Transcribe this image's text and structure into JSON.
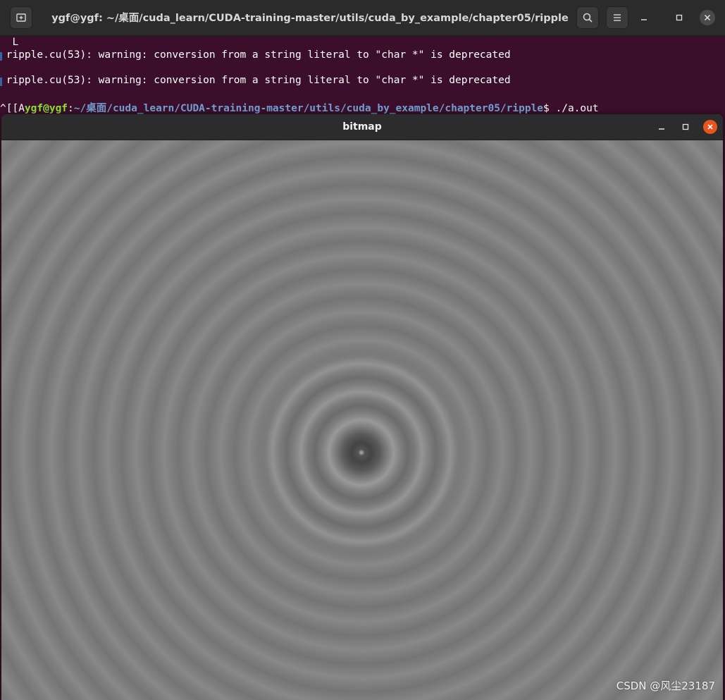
{
  "terminal": {
    "title": "ygf@ygf: ~/桌面/cuda_learn/CUDA-training-master/utils/cuda_by_example/chapter05/ripple",
    "lines": [
      "L",
      "ripple.cu(53): warning: conversion from a string literal to \"char *\" is deprecated",
      "ripple.cu(53): warning: conversion from a string literal to \"char *\" is deprecated"
    ],
    "prompt": {
      "prefix": "^[[A",
      "user": "ygf@ygf",
      "sep": ":",
      "path": "~/桌面/cuda_learn/CUDA-training-master/utils/cuda_by_example/chapter05/ripple",
      "symbol": "$ ",
      "command": "./a.out"
    },
    "icons": {
      "new_tab": "new-tab-icon",
      "search": "search-icon",
      "menu": "hamburger-menu-icon",
      "minimize": "minimize-icon",
      "maximize": "maximize-icon",
      "close": "close-icon"
    }
  },
  "bitmap_window": {
    "title": "bitmap"
  },
  "watermark": "CSDN @风尘23187",
  "colors": {
    "terminal_bg": "#3b0f2c",
    "prompt_user": "#8ae234",
    "prompt_path": "#729fcf",
    "close_button": "#e95420"
  }
}
